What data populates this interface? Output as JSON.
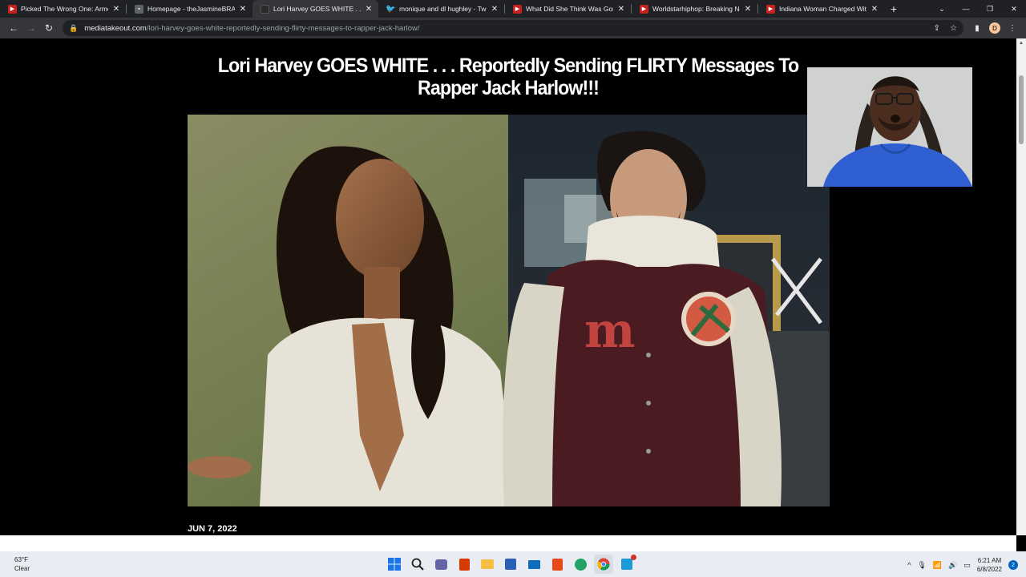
{
  "browser": {
    "tabs": [
      {
        "title": "Picked The Wrong One: Armed",
        "favicon": "red-play-icon",
        "active": false
      },
      {
        "title": "Homepage - theJasmineBRAND",
        "favicon": "site-icon",
        "active": false
      },
      {
        "title": "Lori Harvey GOES WHITE . . . Re",
        "favicon": "page-icon",
        "active": true
      },
      {
        "title": "monique and dl hughley - Twitt",
        "favicon": "twitter-icon",
        "active": false
      },
      {
        "title": "What Did She Think Was Gonna",
        "favicon": "red-play-icon",
        "active": false
      },
      {
        "title": "Worldstarhiphop: Breaking New",
        "favicon": "red-play-icon",
        "active": false
      },
      {
        "title": "Indiana Woman Charged With",
        "favicon": "red-play-icon",
        "active": false
      }
    ],
    "url_domain": "mediatakeout.com",
    "url_path": "/lori-harvey-goes-white-reportedly-sending-flirty-messages-to-rapper-jack-harlow/",
    "profile_initial": "D"
  },
  "article": {
    "headline": "Lori Harvey GOES WHITE . . . Reportedly Sending FLIRTY Messages To Rapper Jack Harlow!!!",
    "date": "JUN 7, 2022"
  },
  "taskbar": {
    "temperature": "63°F",
    "condition": "Clear",
    "time": "6:21 AM",
    "date": "6/8/2022",
    "notification_count": "2"
  },
  "colors": {
    "tab_strip": "#202124",
    "toolbar": "#35363a",
    "page_bg": "#000000",
    "taskbar": "#e9ecf2"
  }
}
